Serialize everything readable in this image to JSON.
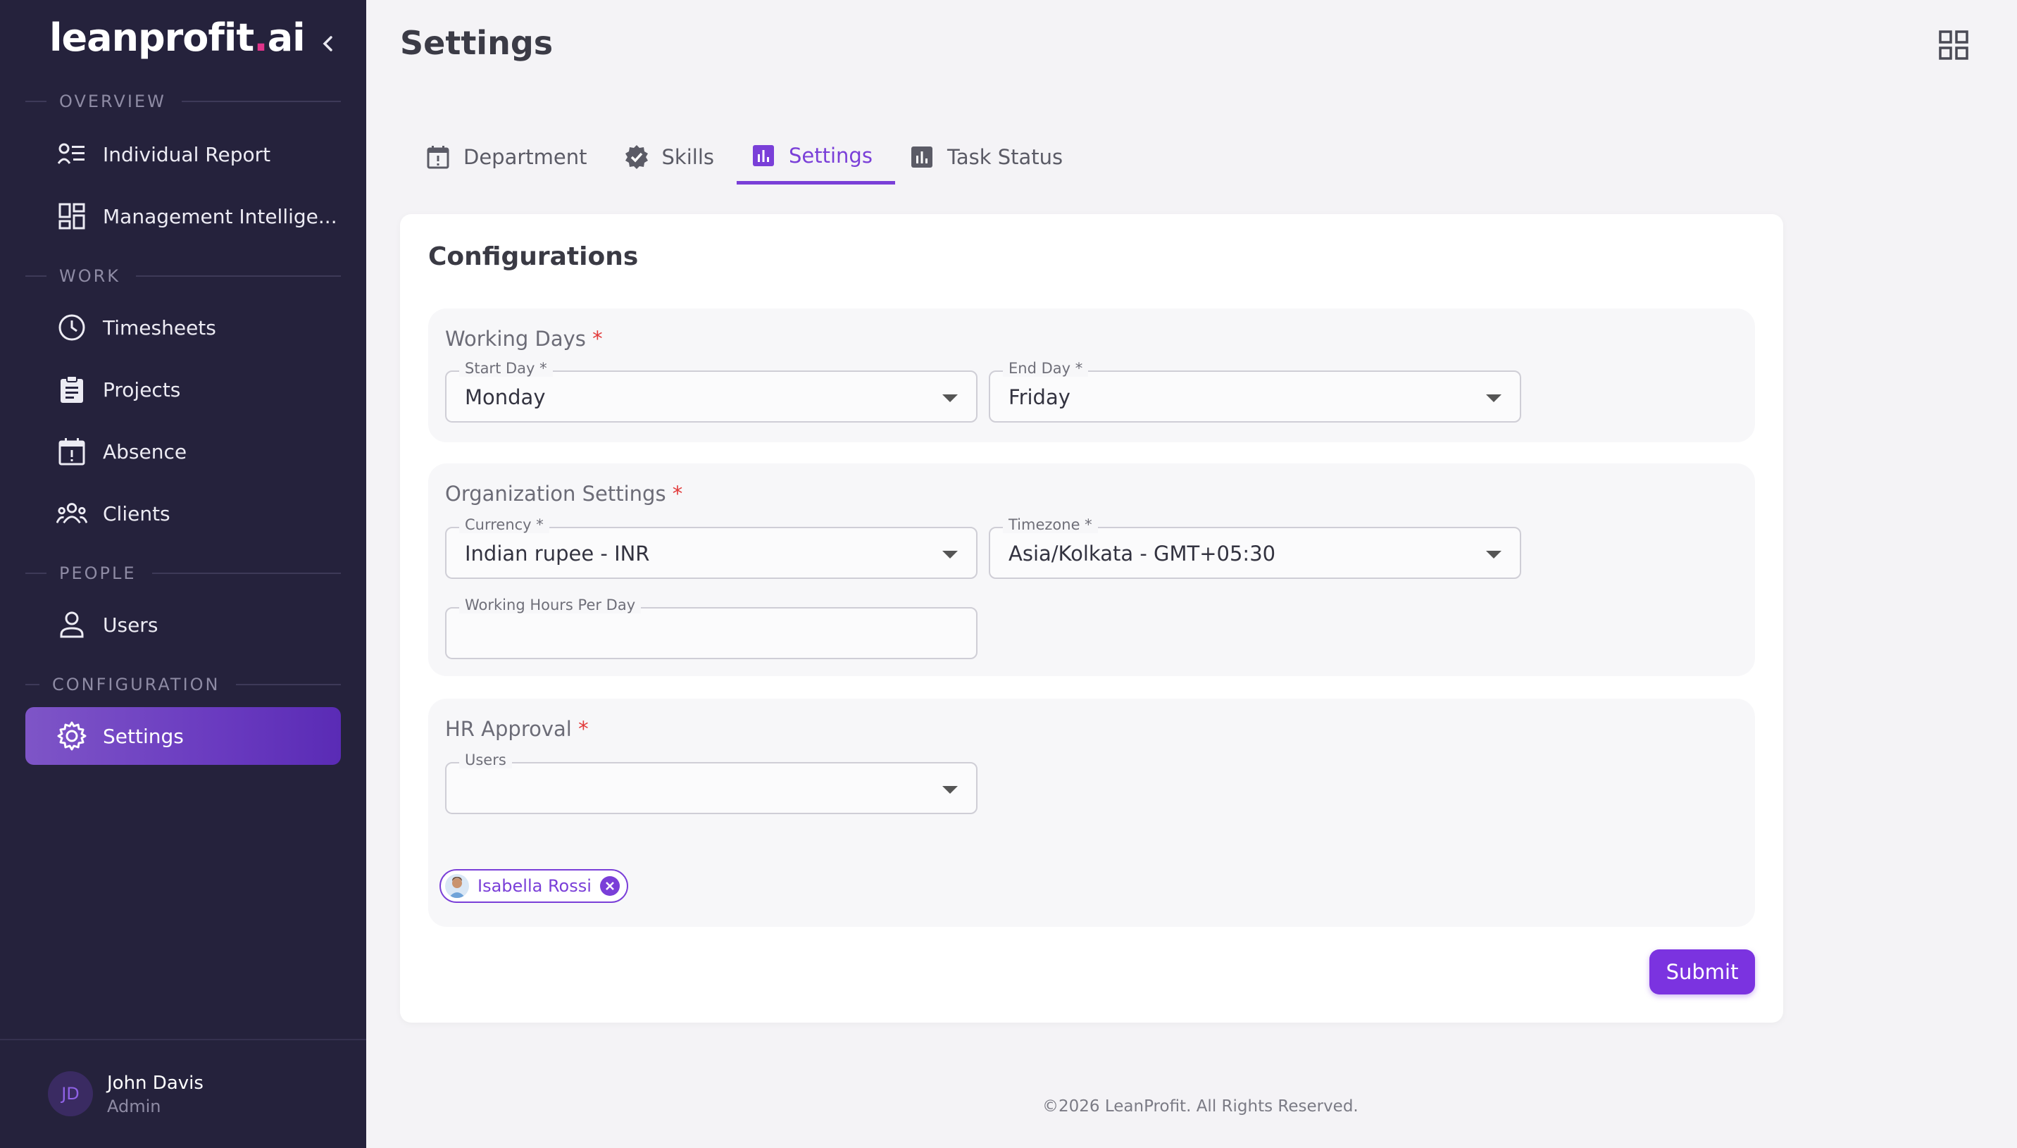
{
  "app": {
    "logo_main": "leanprofit",
    "logo_dot": ".",
    "logo_tld": "ai"
  },
  "sidebar": {
    "sections": [
      {
        "title": "OVERVIEW",
        "items": [
          {
            "label": "Individual Report",
            "icon": "report-list-icon"
          },
          {
            "label": "Management Intellige...",
            "icon": "dashboard-icon"
          }
        ]
      },
      {
        "title": "WORK",
        "items": [
          {
            "label": "Timesheets",
            "icon": "clock-icon"
          },
          {
            "label": "Projects",
            "icon": "clipboard-icon"
          },
          {
            "label": "Absence",
            "icon": "calendar-icon"
          },
          {
            "label": "Clients",
            "icon": "group-icon"
          }
        ]
      },
      {
        "title": "PEOPLE",
        "items": [
          {
            "label": "Users",
            "icon": "person-icon"
          }
        ]
      },
      {
        "title": "CONFIGURATION",
        "items": [
          {
            "label": "Settings",
            "icon": "gear-icon",
            "active": true
          }
        ]
      }
    ],
    "user": {
      "initials": "JD",
      "name": "John Davis",
      "role": "Admin"
    }
  },
  "header": {
    "title": "Settings"
  },
  "tabs": [
    {
      "label": "Department",
      "icon": "calendar-alert-icon"
    },
    {
      "label": "Skills",
      "icon": "verified-badge-icon"
    },
    {
      "label": "Settings",
      "icon": "bar-chart-icon",
      "active": true
    },
    {
      "label": "Task Status",
      "icon": "bar-chart-icon"
    }
  ],
  "config": {
    "title": "Configurations",
    "working_days": {
      "label": "Working Days",
      "required_mark": "*",
      "start_day": {
        "label": "Start Day *",
        "value": "Monday"
      },
      "end_day": {
        "label": "End Day *",
        "value": "Friday"
      }
    },
    "organization": {
      "label": "Organization Settings",
      "required_mark": "*",
      "currency": {
        "label": "Currency *",
        "value": "Indian rupee - INR"
      },
      "timezone": {
        "label": "Timezone *",
        "value": "Asia/Kolkata - GMT+05:30"
      },
      "working_hours": {
        "label": "Working Hours Per Day",
        "value": ""
      }
    },
    "hr_approval": {
      "label": "HR Approval",
      "required_mark": "*",
      "users": {
        "label": "Users",
        "value": ""
      },
      "chips": [
        {
          "label": "Isabella Rossi"
        }
      ]
    },
    "submit_label": "Submit"
  },
  "footer": {
    "copyright": "©2026 LeanProfit. All Rights Reserved."
  },
  "colors": {
    "sidebar_bg": "#25223c",
    "accent": "#7a3fd8",
    "brand_dot": "#e0338a",
    "required": "#e23b3b"
  }
}
